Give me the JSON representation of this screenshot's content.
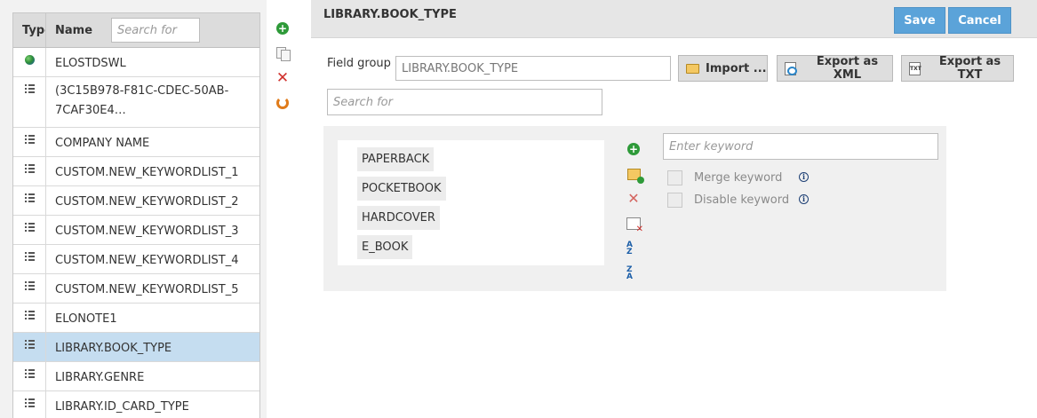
{
  "list": {
    "header": {
      "type": "Type",
      "name": "Name",
      "search_placeholder": "Search for"
    },
    "rows": [
      {
        "icon": "globe-icon",
        "name": "ELOSTDSWL"
      },
      {
        "icon": "list-icon",
        "name": "(3C15B978-F81C-CDEC-50AB-7CAF30E4…"
      },
      {
        "icon": "list-icon",
        "name": "COMPANY NAME"
      },
      {
        "icon": "list-icon",
        "name": "CUSTOM.NEW_KEYWORDLIST_1"
      },
      {
        "icon": "list-icon",
        "name": "CUSTOM.NEW_KEYWORDLIST_2"
      },
      {
        "icon": "list-icon",
        "name": "CUSTOM.NEW_KEYWORDLIST_3"
      },
      {
        "icon": "list-icon",
        "name": "CUSTOM.NEW_KEYWORDLIST_4"
      },
      {
        "icon": "list-icon",
        "name": "CUSTOM.NEW_KEYWORDLIST_5"
      },
      {
        "icon": "list-icon",
        "name": "ELONOTE1"
      },
      {
        "icon": "list-icon",
        "name": "LIBRARY.BOOK_TYPE",
        "selected": true
      },
      {
        "icon": "list-icon",
        "name": "LIBRARY.GENRE"
      },
      {
        "icon": "list-icon",
        "name": "LIBRARY.ID_CARD_TYPE"
      }
    ]
  },
  "side_toolbar": [
    "plus-circle-icon",
    "copy-icon",
    "delete-x-icon",
    "refresh-icon"
  ],
  "header": {
    "title": "LIBRARY.BOOK_TYPE",
    "save_label": "Save",
    "cancel_label": "Cancel"
  },
  "form": {
    "field_group_label": "Field group",
    "field_group_value": "LIBRARY.BOOK_TYPE",
    "search_placeholder": "Search for",
    "import_label": "Import ...",
    "export_xml_label": "Export as XML",
    "export_txt_label": "Export as TXT",
    "txt_icon_text": "TXT"
  },
  "keywords": {
    "items": [
      "PAPERBACK",
      "POCKETBOOK",
      "HARDCOVER",
      "E_BOOK"
    ],
    "keyword_placeholder": "Enter keyword",
    "merge_label": "Merge keyword",
    "disable_label": "Disable keyword",
    "sort_asc_text": "A Z",
    "sort_desc_text": "Z A"
  },
  "colors": {
    "primary": "#5ba3d9",
    "selected_row": "#c5ddf0",
    "add_green": "#2e9a39",
    "delete_red": "#d0312d"
  }
}
